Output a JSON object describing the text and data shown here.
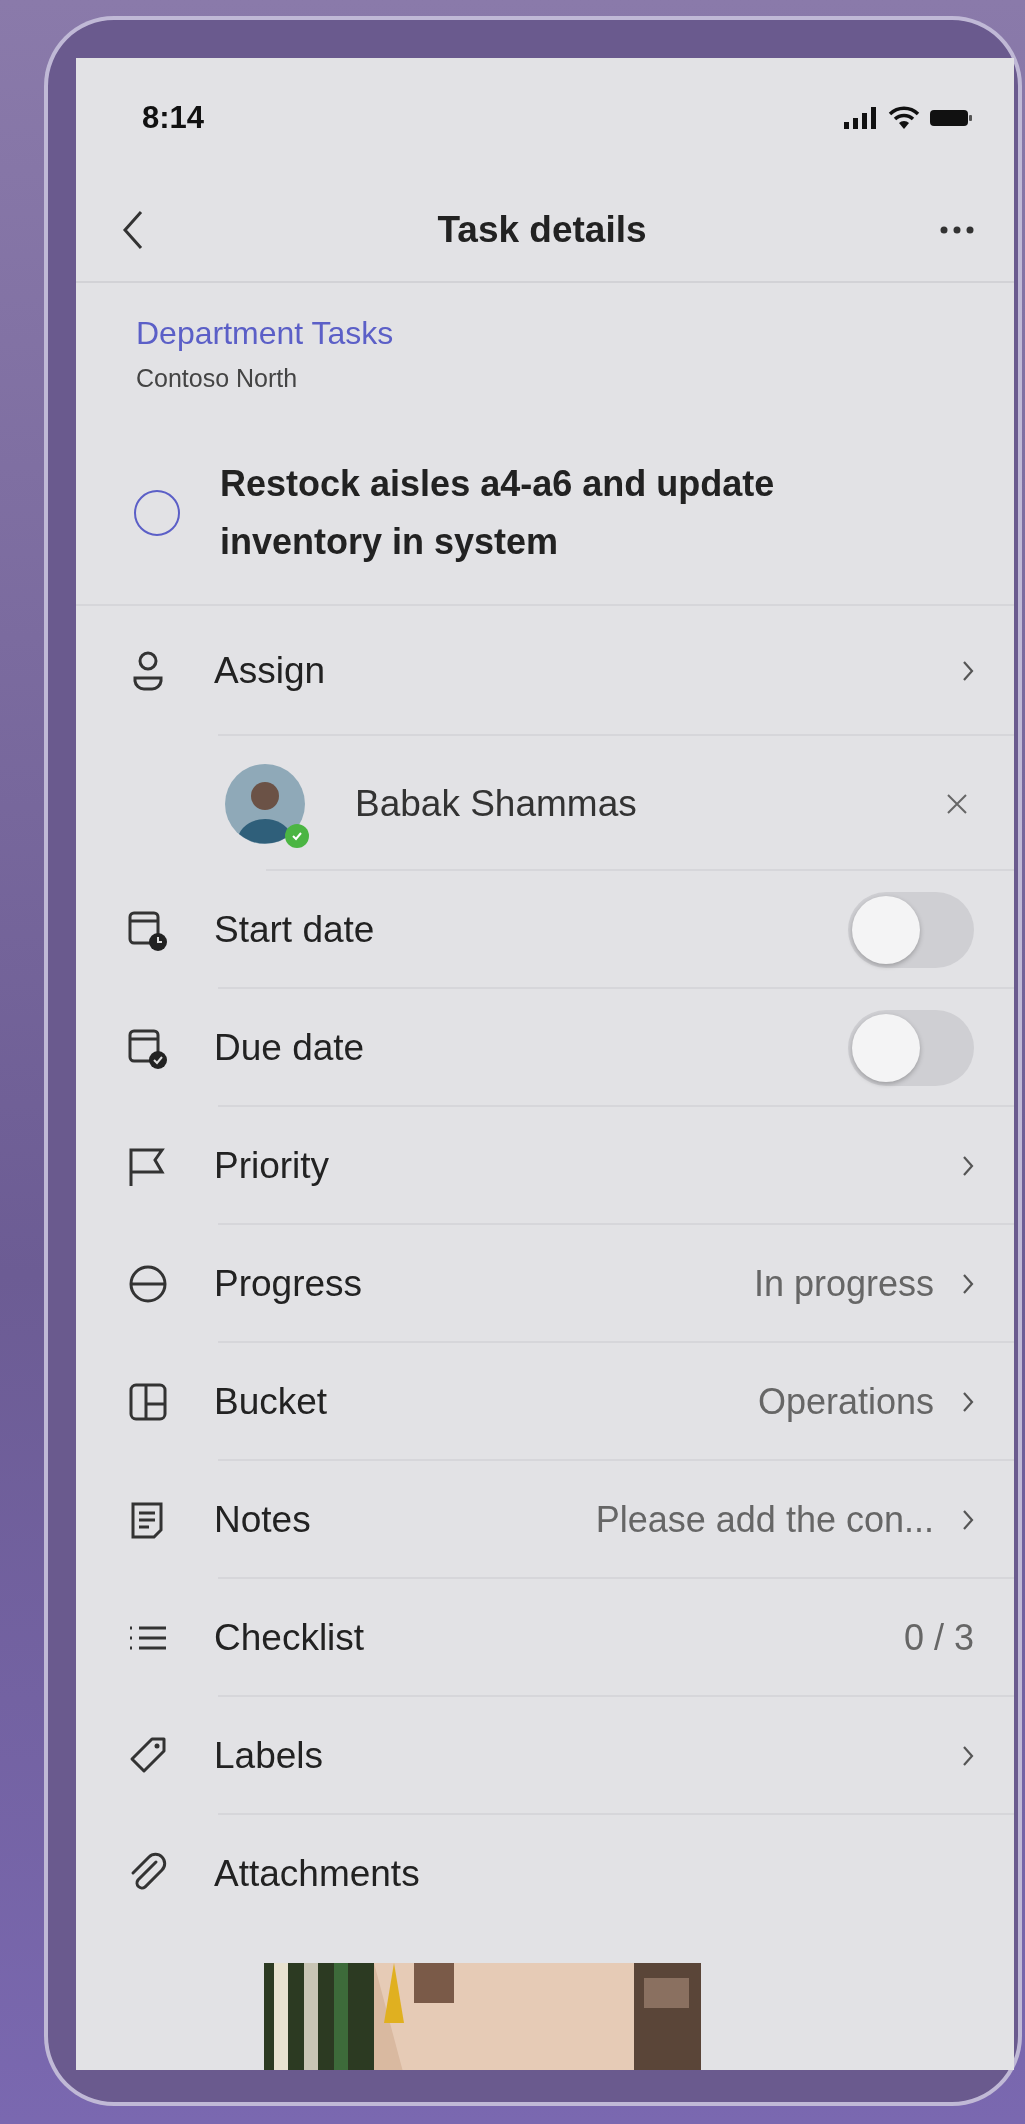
{
  "status_bar": {
    "time": "8:14"
  },
  "header": {
    "title": "Task details"
  },
  "plan": {
    "name": "Department Tasks",
    "group": "Contoso North"
  },
  "task": {
    "title": "Restock aisles a4-a6 and update inventory in system",
    "completed": false
  },
  "assign": {
    "label": "Assign"
  },
  "assignees": [
    {
      "name": "Babak Shammas",
      "color": "#4bb543"
    }
  ],
  "fields": [
    {
      "kind": "toggle",
      "label": "Start date",
      "on": false
    },
    {
      "kind": "toggle",
      "label": "Due date",
      "on": false
    },
    {
      "kind": "link",
      "label": "Priority"
    },
    {
      "kind": "link",
      "label": "Progress",
      "value": "In progress"
    },
    {
      "kind": "link",
      "label": "Bucket",
      "value": "Operations"
    },
    {
      "kind": "link",
      "label": "Notes",
      "value": "Please add the con..."
    },
    {
      "kind": "count",
      "label": "Checklist",
      "value": "0 / 3"
    },
    {
      "kind": "link",
      "label": "Labels"
    },
    {
      "kind": "plain",
      "label": "Attachments"
    }
  ]
}
